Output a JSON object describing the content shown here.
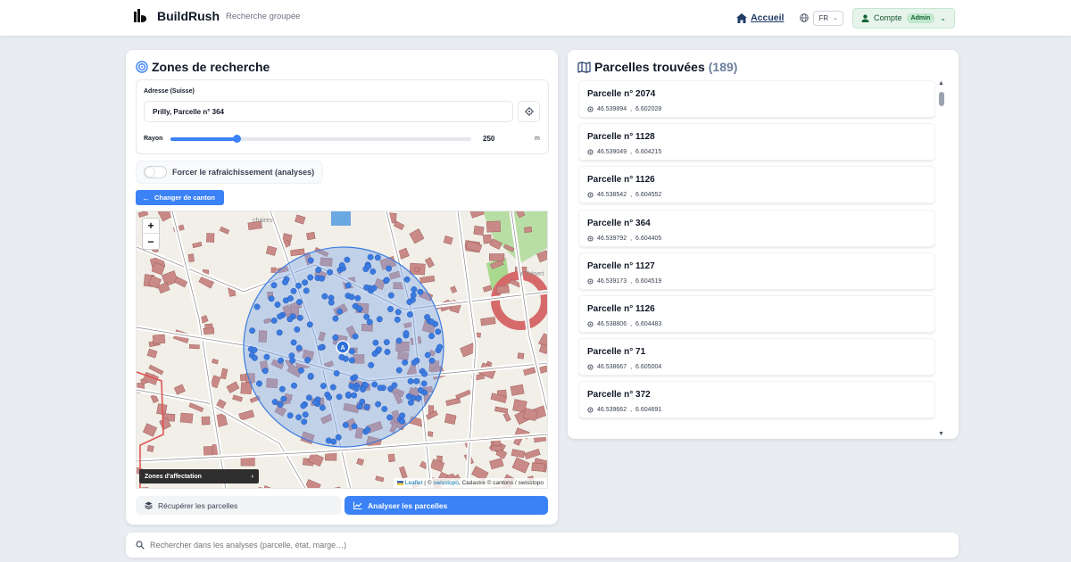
{
  "header": {
    "app_name": "BuildRush",
    "subtitle": "Recherche groupée",
    "home_label": "Accueil",
    "language": "FR",
    "account_label": "Compte",
    "account_badge": "Admin"
  },
  "search_zones": {
    "title": "Zones de recherche",
    "address_label": "Adresse (Suisse)",
    "address_value": "Prilly, Parcelle n° 364",
    "radius_label": "Rayon",
    "radius_value": "250",
    "radius_unit": "m",
    "radius_slider_fraction": 0.22,
    "refresh_label": "Forcer le rafraîchissement (analyses)",
    "refresh_enabled": false,
    "change_canton_label": "Changer de canton",
    "map": {
      "zoom_in": "+",
      "zoom_out": "−",
      "zones_layer_label": "Zones d'affectation",
      "attribution_leaflet": "Leaflet",
      "attribution_sep": " | © ",
      "attribution_swisstopo": "swisstopo",
      "attribution_rest": ", Cadastre © cantons / swisstopo",
      "label_a": "chaires",
      "label_b": "e Désert"
    },
    "fetch_button": "Récupérer les parcelles",
    "analyze_button": "Analyser les parcelles"
  },
  "parcels": {
    "title": "Parcelles trouvées",
    "count": "(189)",
    "items": [
      {
        "name": "Parcelle n° 2074",
        "lat": "46.539894",
        "lon": "6.602028"
      },
      {
        "name": "Parcelle n° 1128",
        "lat": "46.539049",
        "lon": "6.604215"
      },
      {
        "name": "Parcelle n° 1126",
        "lat": "46.538542",
        "lon": "6.604552"
      },
      {
        "name": "Parcelle n° 364",
        "lat": "46.539792",
        "lon": "6.604405"
      },
      {
        "name": "Parcelle n° 1127",
        "lat": "46.539173",
        "lon": "6.604519"
      },
      {
        "name": "Parcelle n° 1126",
        "lat": "46.538806",
        "lon": "6.604483"
      },
      {
        "name": "Parcelle n° 71",
        "lat": "46.538667",
        "lon": "6.605004"
      },
      {
        "name": "Parcelle n° 372",
        "lat": "46.539662",
        "lon": "6.604691"
      }
    ],
    "coord_separator": ","
  },
  "bottom_search": {
    "placeholder": "Rechercher dans les analyses (parcelle, état, marge…)"
  },
  "colors": {
    "accent": "#3b82f6",
    "marker": "#3b7be0",
    "radius_fill": "#7fa6e6"
  }
}
